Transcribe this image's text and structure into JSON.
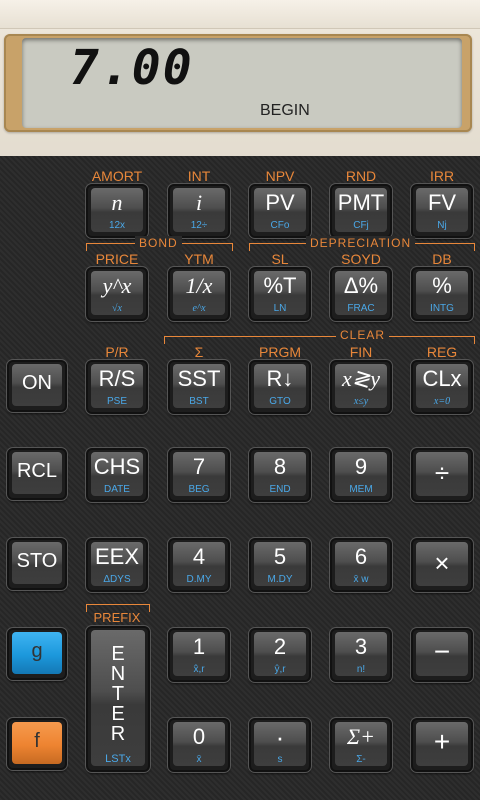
{
  "display": {
    "value": "7.00",
    "status": "BEGIN"
  },
  "row1_labels": [
    "AMORT",
    "INT",
    "NPV",
    "RND",
    "IRR"
  ],
  "row1_keys": [
    {
      "main": "n",
      "sub": "12x"
    },
    {
      "main": "i",
      "sub": "12÷"
    },
    {
      "main": "PV",
      "sub": "CFo"
    },
    {
      "main": "PMT",
      "sub": "CFj"
    },
    {
      "main": "FV",
      "sub": "Nj"
    }
  ],
  "bond_label": "BOND",
  "depreciation_label": "DEPRECIATION",
  "row2_labels": [
    "PRICE",
    "YTM",
    "SL",
    "SOYD",
    "DB"
  ],
  "row2_keys": [
    {
      "main": "y^x",
      "sub": "√x"
    },
    {
      "main": "1/x",
      "sub": "e^x"
    },
    {
      "main": "%T",
      "sub": "LN"
    },
    {
      "main": "Δ%",
      "sub": "FRAC"
    },
    {
      "main": "%",
      "sub": "INTG"
    }
  ],
  "clear_label": "CLEAR",
  "row3_labels": [
    "P/R",
    "Σ",
    "PRGM",
    "FIN",
    "REG"
  ],
  "row3_keys": [
    {
      "main": "R/S",
      "sub": "PSE"
    },
    {
      "main": "SST",
      "sub": "BST"
    },
    {
      "main": "R↓",
      "sub": "GTO"
    },
    {
      "main": "x≷y",
      "sub": "x≤y"
    },
    {
      "main": "CLx",
      "sub": "x=0"
    }
  ],
  "side_keys": {
    "on": "ON",
    "rcl": "RCL",
    "sto": "STO",
    "g": "g",
    "f": "f"
  },
  "row4_keys": [
    {
      "main": "CHS",
      "sub": "DATE"
    },
    {
      "main": "7",
      "sub": "BEG"
    },
    {
      "main": "8",
      "sub": "END"
    },
    {
      "main": "9",
      "sub": "MEM"
    },
    {
      "main": "÷",
      "sub": ""
    }
  ],
  "row5_keys": [
    {
      "main": "EEX",
      "sub": "ΔDYS"
    },
    {
      "main": "4",
      "sub": "D.MY"
    },
    {
      "main": "5",
      "sub": "M.DY"
    },
    {
      "main": "6",
      "sub": "x̄ w"
    },
    {
      "main": "×",
      "sub": ""
    }
  ],
  "prefix_label": "PREFIX",
  "enter_key": {
    "letters": [
      "E",
      "N",
      "T",
      "E",
      "R"
    ],
    "sub": "LSTx"
  },
  "row6_keys": [
    {
      "main": "1",
      "sub": "x̂,r"
    },
    {
      "main": "2",
      "sub": "ŷ,r"
    },
    {
      "main": "3",
      "sub": "n!"
    },
    {
      "main": "−",
      "sub": ""
    }
  ],
  "row7_keys": [
    {
      "main": "0",
      "sub": "x̄"
    },
    {
      "main": "·",
      "sub": "s"
    },
    {
      "main": "Σ+",
      "sub": "Σ-"
    },
    {
      "main": "+",
      "sub": ""
    }
  ]
}
